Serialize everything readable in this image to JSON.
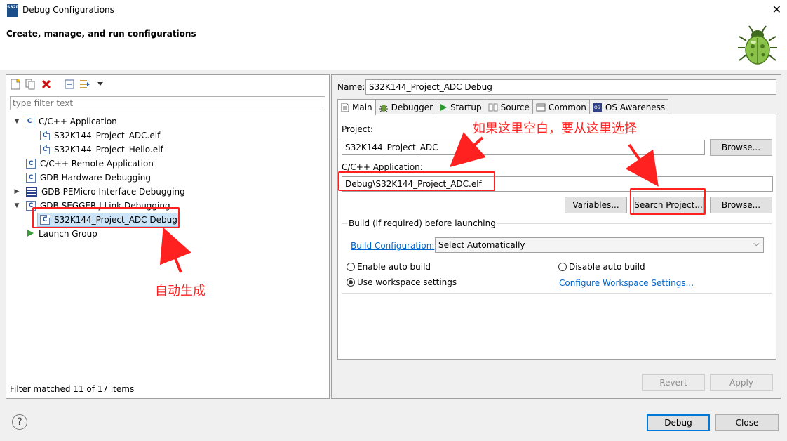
{
  "window": {
    "title": "Debug Configurations",
    "app_icon_text": "S32DS",
    "close_glyph": "✕"
  },
  "banner": {
    "title": "Create, manage, and run configurations"
  },
  "left": {
    "filter_placeholder": "type filter text",
    "tree": [
      {
        "label": "C/C++ Application",
        "expanded": true,
        "icon": "c-app-icon"
      },
      {
        "label": "S32K144_Project_ADC.elf",
        "child": true,
        "icon": "c-launch-icon"
      },
      {
        "label": "S32K144_Project_Hello.elf",
        "child": true,
        "icon": "c-launch-icon"
      },
      {
        "label": "C/C++ Remote Application",
        "icon": "c-app-icon"
      },
      {
        "label": "GDB Hardware Debugging",
        "icon": "c-app-icon"
      },
      {
        "label": "GDB PEMicro Interface Debugging",
        "collapsed": true,
        "icon": "pemicro-icon"
      },
      {
        "label": "GDB SEGGER J-Link Debugging",
        "expanded": true,
        "icon": "c-app-icon"
      },
      {
        "label": "S32K144_Project_ADC Debug",
        "child": true,
        "selected": true,
        "icon": "c-launch-icon"
      },
      {
        "label": "Launch Group",
        "icon": "launch-group-icon"
      }
    ],
    "status": "Filter matched 11 of 17 items"
  },
  "right": {
    "name_label": "Name:",
    "name_value": "S32K144_Project_ADC Debug",
    "tabs": [
      "Main",
      "Debugger",
      "Startup",
      "Source",
      "Common",
      "OS Awareness"
    ],
    "project_label": "Project:",
    "project_value": "S32K144_Project_ADC",
    "browse_label": "Browse...",
    "app_label": "C/C++ Application:",
    "app_value": "Debug\\S32K144_Project_ADC.elf",
    "variables_label": "Variables...",
    "search_project_label": "Search Project...",
    "build_group_title": "Build (if required) before launching",
    "build_config_link": "Build Configuration:",
    "build_config_value": "Select Automatically",
    "enable_auto_build": "Enable auto build",
    "disable_auto_build": "Disable auto build",
    "use_workspace": "Use workspace settings",
    "configure_workspace_link": "Configure Workspace Settings...",
    "revert_label": "Revert",
    "apply_label": "Apply"
  },
  "footer": {
    "help_glyph": "?",
    "debug_label": "Debug",
    "close_label": "Close"
  },
  "annotations": {
    "auto_generated": "自动生成",
    "if_blank_select": "如果这里空白，要从这里选择"
  },
  "colors": {
    "annotation_red": "#ff2020",
    "link_blue": "#0066cc",
    "selection_bg": "#cce4f7"
  }
}
